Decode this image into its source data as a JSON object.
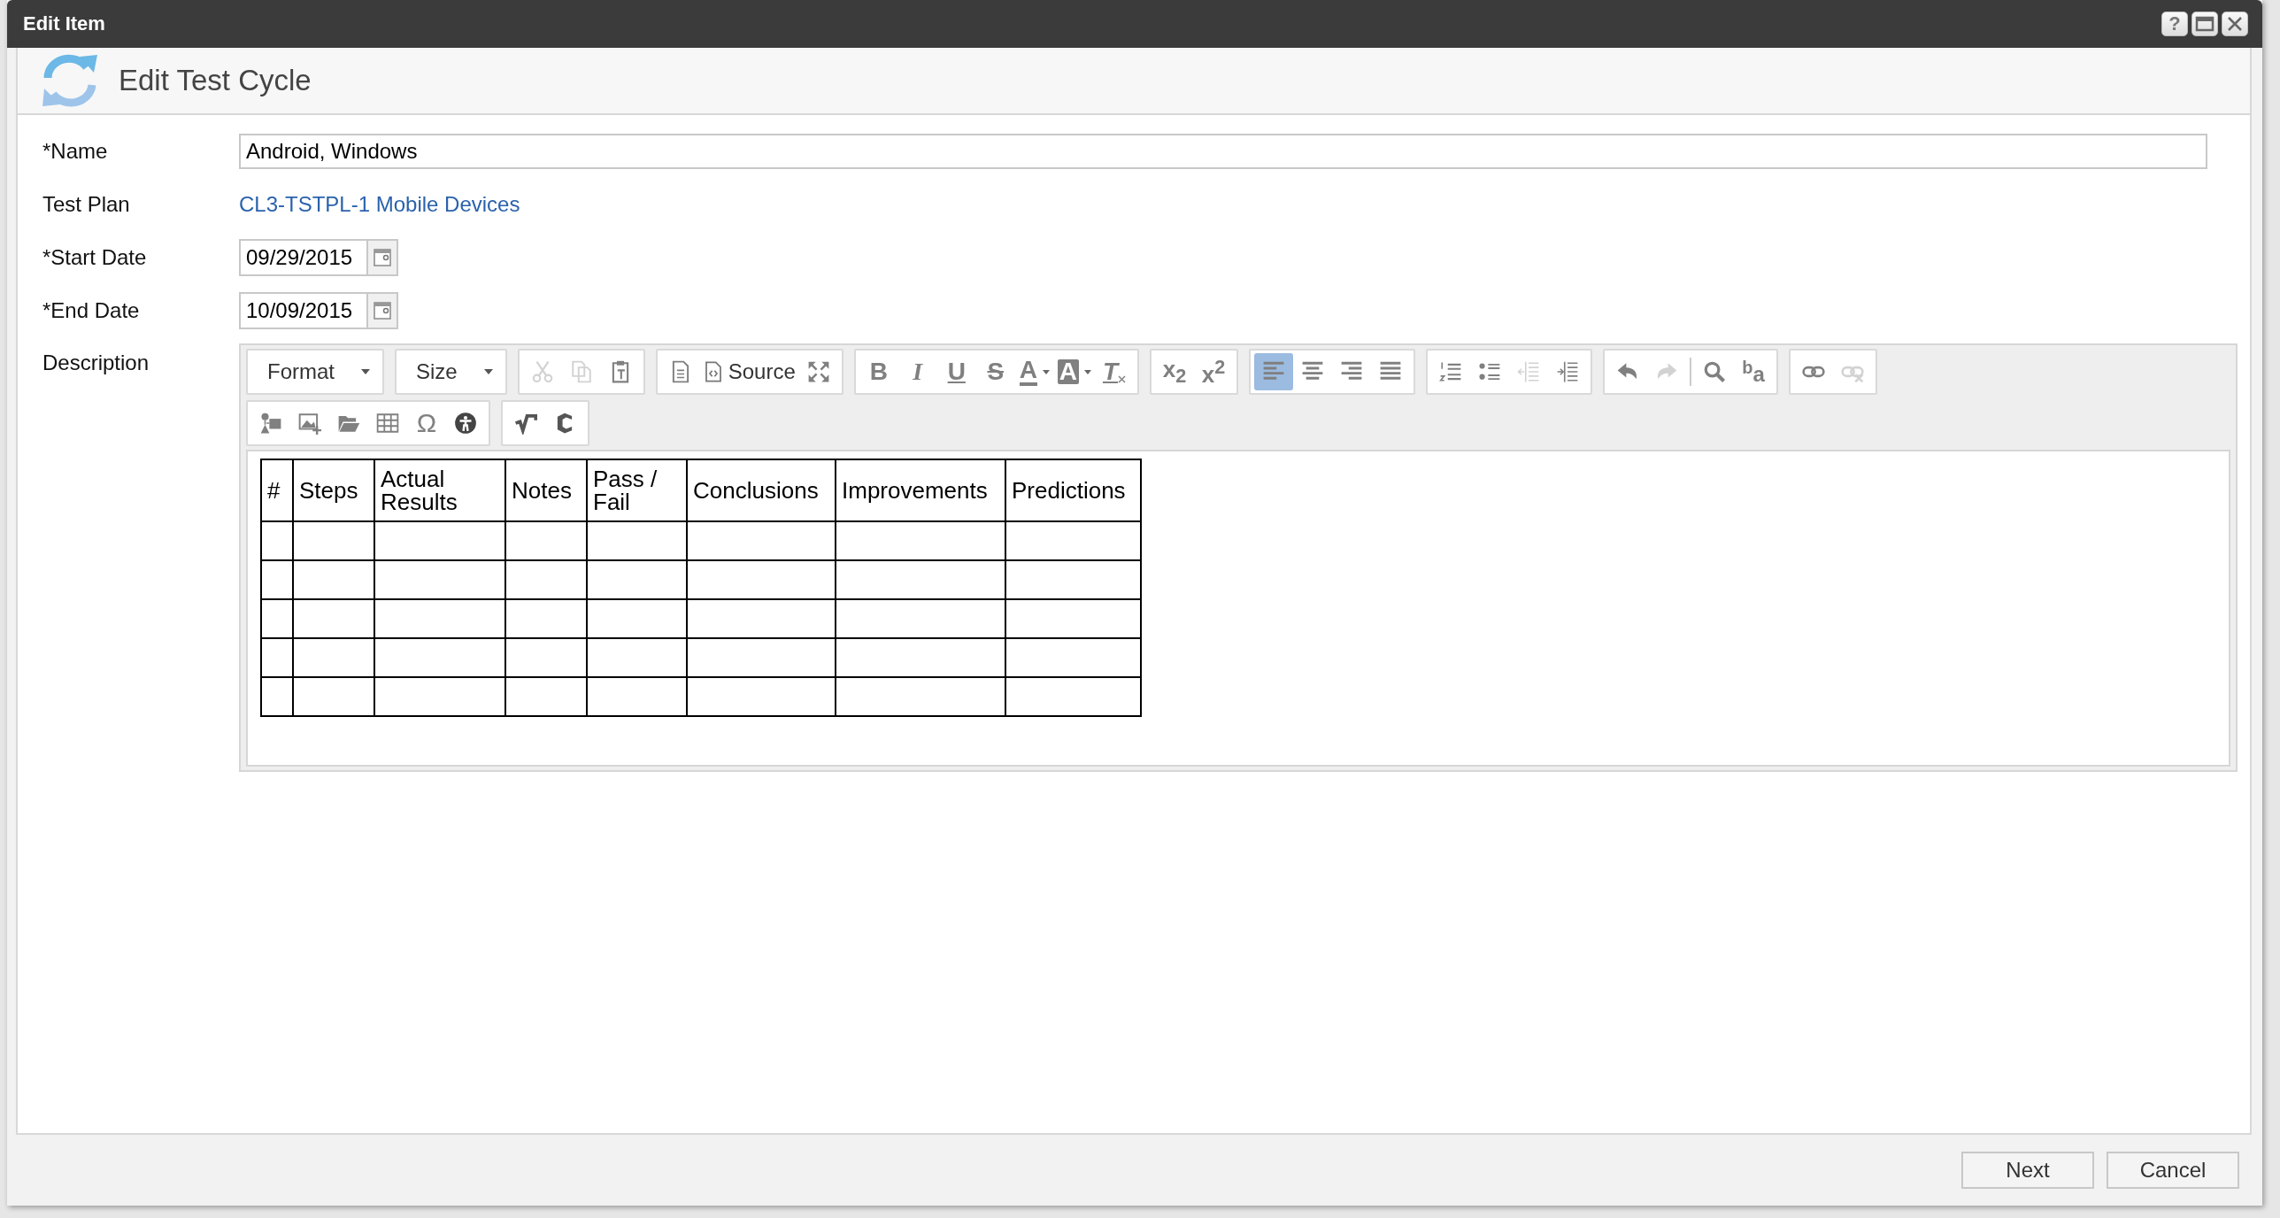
{
  "window": {
    "title": "Edit Item",
    "controls": [
      {
        "kind": "help",
        "glyph": "?"
      },
      {
        "kind": "maximize"
      },
      {
        "kind": "close"
      }
    ]
  },
  "header": {
    "title": "Edit Test Cycle"
  },
  "form": {
    "name": {
      "label": "*Name",
      "value": "Android, Windows"
    },
    "test_plan": {
      "label": "Test Plan",
      "link": "CL3-TSTPL-1 Mobile Devices"
    },
    "start_date": {
      "label": "*Start Date",
      "value": "09/29/2015"
    },
    "end_date": {
      "label": "*End Date",
      "value": "10/09/2015"
    },
    "description": {
      "label": "Description"
    }
  },
  "editor": {
    "toolbar_rows": [
      {
        "groups": [
          {
            "buttons": [
              {
                "kind": "dropdown",
                "label": "Format",
                "disabled": false,
                "selected": false
              }
            ]
          },
          {
            "buttons": [
              {
                "kind": "dropdown",
                "label": "Size",
                "disabled": false,
                "selected": false
              }
            ]
          },
          {
            "buttons": [
              {
                "kind": "cut",
                "disabled": true,
                "selected": false
              },
              {
                "kind": "copy",
                "disabled": true,
                "selected": false
              },
              {
                "kind": "paste",
                "disabled": false,
                "selected": false
              }
            ]
          },
          {
            "buttons": [
              {
                "kind": "document",
                "disabled": false,
                "selected": false
              },
              {
                "kind": "source",
                "label": "Source",
                "disabled": false,
                "selected": false
              },
              {
                "kind": "maximize",
                "disabled": false,
                "selected": false
              }
            ]
          },
          {
            "buttons": [
              {
                "kind": "bold",
                "glyph": "B",
                "disabled": false,
                "selected": false
              },
              {
                "kind": "italic",
                "glyph": "I",
                "disabled": false,
                "selected": false
              },
              {
                "kind": "underline",
                "glyph": "U",
                "disabled": false,
                "selected": false
              },
              {
                "kind": "strike",
                "glyph": "S",
                "disabled": false,
                "selected": false
              },
              {
                "kind": "textcolor",
                "glyph": "A",
                "disabled": false,
                "selected": false
              },
              {
                "kind": "bgcolor",
                "glyph": "A",
                "disabled": false,
                "selected": false
              },
              {
                "kind": "clearformat",
                "glyph": "T",
                "disabled": false,
                "selected": false
              }
            ]
          },
          {
            "buttons": [
              {
                "kind": "script",
                "glyph": "x$_{2}$",
                "disabled": false,
                "selected": false
              },
              {
                "kind": "script",
                "glyph": "x$^{2}$",
                "disabled": false,
                "selected": false
              }
            ]
          },
          {
            "buttons": [
              {
                "kind": "alignleft",
                "disabled": false,
                "selected": true
              },
              {
                "kind": "aligncenter",
                "disabled": false,
                "selected": false
              },
              {
                "kind": "alignright",
                "disabled": false,
                "selected": false
              },
              {
                "kind": "justify",
                "disabled": false,
                "selected": false
              }
            ]
          },
          {
            "buttons": [
              {
                "kind": "numbered",
                "disabled": false,
                "selected": false
              },
              {
                "kind": "bulleted",
                "disabled": false,
                "selected": false
              },
              {
                "kind": "outdent",
                "disabled": true,
                "selected": false
              },
              {
                "kind": "indent",
                "disabled": false,
                "selected": false
              }
            ]
          },
          {
            "buttons": [
              {
                "kind": "undo",
                "disabled": false,
                "selected": false
              },
              {
                "kind": "redo",
                "disabled": true,
                "selected": false
              },
              {
                "kind": "separator"
              },
              {
                "kind": "find",
                "disabled": false,
                "selected": false
              },
              {
                "kind": "replace",
                "glyph": "$^{b}$a",
                "disabled": false,
                "selected": false
              }
            ]
          },
          {
            "buttons": [
              {
                "kind": "link",
                "disabled": false,
                "selected": false
              },
              {
                "kind": "unlink",
                "disabled": true,
                "selected": false
              }
            ]
          }
        ]
      },
      {
        "groups": [
          {
            "buttons": [
              {
                "kind": "shapes",
                "disabled": false,
                "selected": false
              },
              {
                "kind": "image",
                "disabled": false,
                "selected": false
              },
              {
                "kind": "folder",
                "disabled": false,
                "selected": false
              },
              {
                "kind": "table",
                "disabled": false,
                "selected": false
              },
              {
                "kind": "symbol",
                "glyph": "Ω",
                "disabled": false,
                "selected": false
              },
              {
                "kind": "accessibility",
                "disabled": false,
                "selected": false
              }
            ]
          },
          {
            "buttons": [
              {
                "kind": "sqrt",
                "disabled": false,
                "selected": false
              },
              {
                "kind": "cshape",
                "disabled": false,
                "selected": false
              }
            ]
          }
        ]
      }
    ],
    "table": {
      "columns": [
        "#",
        "Steps",
        "Actual Results",
        "Notes",
        "Pass / Fail",
        "Conclusions",
        "Improvements",
        "Predictions"
      ]
    }
  },
  "buttons": [
    {
      "label": "Next"
    },
    {
      "label": "Cancel"
    }
  ]
}
